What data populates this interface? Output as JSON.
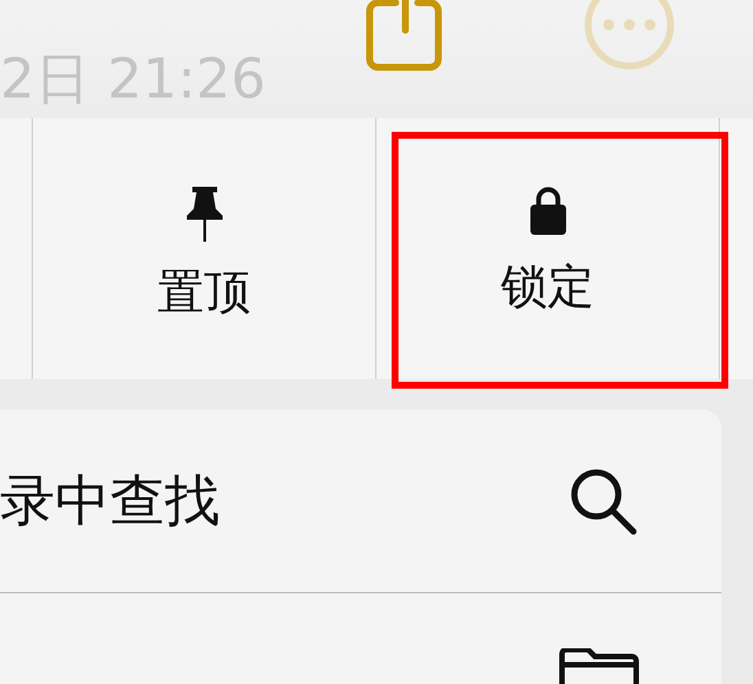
{
  "header": {
    "date": "2日 21:26"
  },
  "actions": [
    {
      "label": "置顶",
      "kind": "pin",
      "highlighted": false
    },
    {
      "label": "锁定",
      "kind": "lock",
      "highlighted": true
    }
  ],
  "menu": [
    {
      "label": "录中查找",
      "kind": "search"
    },
    {
      "kind": "folder"
    }
  ]
}
